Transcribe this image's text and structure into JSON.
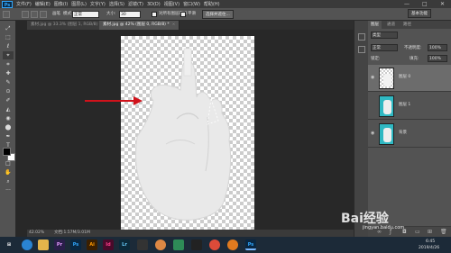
{
  "app": {
    "name": "Ps",
    "brand_color": "#31a8ff"
  },
  "menu": [
    "文件(F)",
    "编辑(E)",
    "图像(I)",
    "图层(L)",
    "文字(Y)",
    "选择(S)",
    "滤镜(T)",
    "3D(D)",
    "视图(V)",
    "窗口(W)",
    "帮助(H)"
  ],
  "window_controls": {
    "min": "—",
    "max": "□",
    "close": "✕"
  },
  "options": {
    "size_label": "大小:",
    "size_value": "30",
    "mode_label": "模式",
    "mode_value": "正常",
    "opacity_label": "不透明度:",
    "opacity_value": "100%",
    "brush_label": "画笔",
    "checkbox_label": "对所有图层取样",
    "smooth_label": "平滑",
    "refine_button": "选择并遮住...",
    "workspace_button": "基本功能"
  },
  "tabs": [
    {
      "label": "素材.jpg @ 33.3% (图层 1, RGB/8) *",
      "active": false
    },
    {
      "label": "素材.jpg @ 42% (图层 0, RGB/8) *",
      "active": true
    }
  ],
  "tab_close": "×",
  "tools": [
    "⤢",
    "⬚",
    "ℓ",
    "⌖",
    "⌗",
    "✚",
    "✎",
    "⊙",
    "✐",
    "◭",
    "◉",
    "⬤",
    "✒",
    "T",
    "⬊",
    "□",
    "✋",
    "⌕",
    "···"
  ],
  "status": {
    "zoom": "42.02%",
    "doc_info": "文档:1.57M/3.01M"
  },
  "panels": {
    "tabs": [
      "图层",
      "通道",
      "路径"
    ],
    "search_label": "类型",
    "blend_mode": "正常",
    "opacity_label": "不透明度:",
    "opacity_value": "100%",
    "lock_label": "锁定:",
    "fill_label": "填充:",
    "fill_value": "100%",
    "layers": [
      {
        "name": "图层 0",
        "visible": true,
        "selected": true
      },
      {
        "name": "图层 1",
        "visible": false,
        "selected": false
      },
      {
        "name": "背景",
        "visible": true,
        "selected": false
      }
    ]
  },
  "taskbar": {
    "apps": [
      {
        "name": "start",
        "label": "",
        "color": "#1c2a38"
      },
      {
        "name": "cortana",
        "label": "",
        "color": "#2a84d2"
      },
      {
        "name": "explorer",
        "label": "",
        "color": "#e4b54b"
      },
      {
        "name": "premiere",
        "label": "Pr",
        "color": "#2a1e4a"
      },
      {
        "name": "photoshop",
        "label": "Ps",
        "color": "#0a2741"
      },
      {
        "name": "ae",
        "label": "Ai",
        "color": "#3a1f00"
      },
      {
        "name": "indesign",
        "label": "Id",
        "color": "#4a0a2a"
      },
      {
        "name": "lightroom",
        "label": "Lr",
        "color": "#0b2a3a"
      },
      {
        "name": "media",
        "label": "",
        "color": "#333"
      },
      {
        "name": "game",
        "label": "",
        "color": "#d84"
      },
      {
        "name": "green-app",
        "label": "",
        "color": "#2e8b57"
      },
      {
        "name": "qq",
        "label": "",
        "color": "#222"
      },
      {
        "name": "chrome",
        "label": "",
        "color": "#dd4b39"
      },
      {
        "name": "orange-app",
        "label": "",
        "color": "#e07a1f"
      },
      {
        "name": "ps-active",
        "label": "Ps",
        "color": "#0a2741"
      }
    ],
    "time": "6:45",
    "date": "2019/4/26",
    "watermark_text": "Bai经验",
    "watermark_url": "jingyan.baidu.com"
  }
}
